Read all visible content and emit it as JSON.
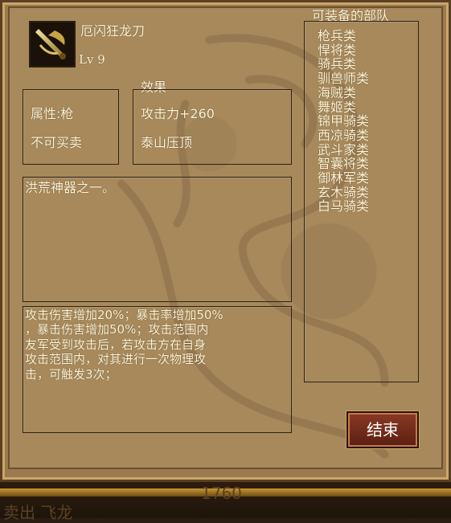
{
  "item": {
    "name": "厄闪狂龙刀",
    "level": "Lv 9",
    "attribute": "属性:枪",
    "trade": "不可买卖",
    "effect_title": "效果",
    "effect_attack": "攻击力+260",
    "effect_skill": "泰山压顶",
    "summary": "洪荒神器之一。",
    "description_lines": [
      "攻击伤害增加20%；暴击率增加50%",
      "，暴击伤害增加50%；攻击范围内",
      "友军受到攻击后，若攻击方在自身",
      "攻击范围内，对其进行一次物理攻",
      "击，可触发3次；"
    ],
    "icon": "sword-icon"
  },
  "equip": {
    "title": "可装备的部队",
    "units": [
      "枪兵类",
      "悍将类",
      "骑兵类",
      "驯兽师类",
      "海贼类",
      "舞姬类",
      "锦甲骑类",
      "西凉骑类",
      "武斗家类",
      "智囊将类",
      "御林军类",
      "玄木骑类",
      "白马骑类"
    ]
  },
  "buttons": {
    "end": "结束"
  },
  "footer": {
    "ghost_number": "1760",
    "ghost_text": "卖出 飞龙"
  },
  "colors": {
    "panel": "#a7895c",
    "text": "#fff6d6",
    "button": "#7a3220"
  }
}
